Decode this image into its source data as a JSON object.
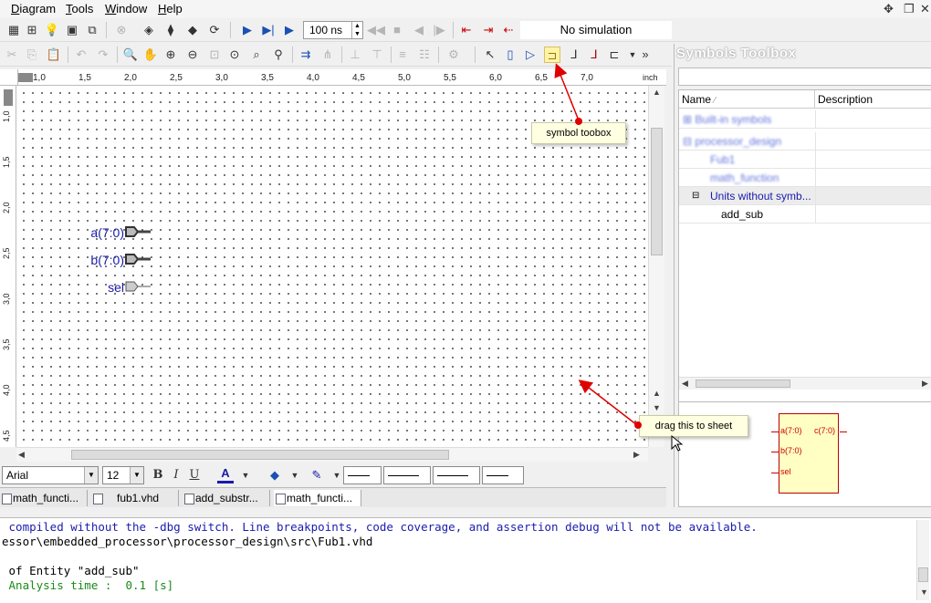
{
  "menu": {
    "items": [
      {
        "label": "Diagram",
        "icon": ""
      },
      {
        "label": "Tools",
        "icon": ""
      },
      {
        "label": "Window",
        "icon": ""
      },
      {
        "label": "Help",
        "icon": ""
      }
    ],
    "window_controls": [
      "move-icon",
      "restore-icon",
      "close-icon"
    ]
  },
  "toolbar": {
    "sim_time_value": "100 ns",
    "sim_status": "No simulation",
    "colors": {
      "run": "#1a4fb3",
      "stop": "#c00000",
      "disabled": "#b5b5b5"
    }
  },
  "ruler": {
    "unit": "inch",
    "h_ticks": [
      "1,0",
      "1,5",
      "2,0",
      "2,5",
      "3,0",
      "3,5",
      "4,0",
      "4,5",
      "5,0",
      "5,5",
      "6,0",
      "6,5",
      "7,0"
    ],
    "v_ticks": [
      "1,0",
      "1,5",
      "2,0",
      "2,5",
      "3,0",
      "3,5",
      "4,0",
      "4,5"
    ]
  },
  "canvas": {
    "ports": [
      {
        "label": "a(7:0)",
        "kind": "bus-input"
      },
      {
        "label": "b(7:0)",
        "kind": "bus-input"
      },
      {
        "label": "sel",
        "kind": "input"
      }
    ]
  },
  "format_bar": {
    "font_name": "Arial",
    "font_size": "12",
    "bold": "B",
    "italic": "I",
    "underline": "U"
  },
  "tabs": [
    {
      "label": "math_functi..."
    },
    {
      "label": "fub1.vhd"
    },
    {
      "label": "add_substr..."
    },
    {
      "label": "math_functi..."
    }
  ],
  "symbols_toolbox": {
    "title": "Symbols Toolbox",
    "col_name": "Name",
    "col_description": "Description",
    "rows": [
      {
        "label": "Built-in symbols",
        "blurred": true
      },
      {
        "label": "processor_design",
        "blurred": true
      },
      {
        "label": "Fub1",
        "blurred": true
      },
      {
        "label": "math_function",
        "blurred": true
      },
      {
        "label": "Units without symb...",
        "blurred": false
      },
      {
        "label": "add_sub",
        "blurred": false
      }
    ],
    "preview": {
      "inputs": [
        "a(7:0)",
        "b(7:0)",
        "sel"
      ],
      "outputs": [
        "c(7:0)"
      ]
    }
  },
  "console": {
    "lines": [
      {
        "text": " compiled without the -dbg switch. Line breakpoints, code coverage, and assertion debug will not be available.",
        "color": "#1a1ab0"
      },
      {
        "text": "essor\\embedded_processor\\processor_design\\src\\Fub1.vhd",
        "color": "#000000"
      },
      {
        "text": "",
        "color": "#000000"
      },
      {
        "text": " of Entity \"add_sub\"",
        "color": "#000000"
      },
      {
        "text": " Analysis time :  0.1 [s]",
        "color": "#1a8a1a"
      }
    ]
  },
  "annotations": {
    "symbol_toolbox_note": "symbol toobox",
    "drag_note": "drag this to sheet",
    "arrow_color": "#e00000"
  }
}
